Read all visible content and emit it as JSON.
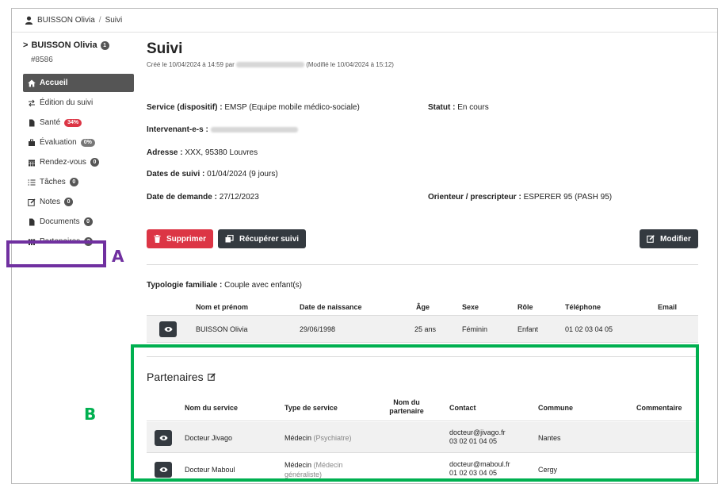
{
  "breadcrumb": {
    "person": "BUISSON Olivia",
    "separator": "/",
    "page": "Suivi"
  },
  "sidebar": {
    "patient_name": "BUISSON Olivia",
    "patient_badge": "1",
    "patient_id": "#8586",
    "items": [
      {
        "label": "Accueil",
        "icon": "home-icon",
        "badge": ""
      },
      {
        "label": "Édition du suivi",
        "icon": "swap-arrows-icon",
        "badge": ""
      },
      {
        "label": "Santé",
        "icon": "file-icon",
        "badge": "34%"
      },
      {
        "label": "Évaluation",
        "icon": "briefcase-icon",
        "badge": "0%"
      },
      {
        "label": "Rendez-vous",
        "icon": "calendar-icon",
        "badge": "0"
      },
      {
        "label": "Tâches",
        "icon": "list-icon",
        "badge": "0"
      },
      {
        "label": "Notes",
        "icon": "edit-icon",
        "badge": "0"
      },
      {
        "label": "Documents",
        "icon": "file-icon",
        "badge": "0"
      },
      {
        "label": "Partenaires",
        "icon": "people-icon",
        "badge": "2"
      }
    ]
  },
  "main": {
    "title": "Suivi",
    "meta_prefix": "Créé le 10/04/2024 à 14:59 par",
    "meta_suffix": "(Modifié le 10/04/2024 à 15:12)",
    "service_label": "Service (dispositif) :",
    "service_value": "EMSP (Equipe mobile médico-sociale)",
    "statut_label": "Statut :",
    "statut_value": "En cours",
    "intervenant_label": "Intervenant-e-s :",
    "adresse_label": "Adresse :",
    "adresse_value": "XXX, 95380 Louvres",
    "dates_label": "Dates de suivi :",
    "dates_value": "01/04/2024 (9 jours)",
    "demande_label": "Date de demande :",
    "demande_value": "27/12/2023",
    "orienteur_label": "Orienteur / prescripteur :",
    "orienteur_value": "ESPERER 95 (PASH 95)",
    "btn_supprimer": "Supprimer",
    "btn_recuperer": "Récupérer suivi",
    "btn_modifier": "Modifier",
    "typologie_label": "Typologie familiale :",
    "typologie_value": "Couple avec enfant(s)"
  },
  "family_table": {
    "headers": [
      "Nom et prénom",
      "Date de naissance",
      "Âge",
      "Sexe",
      "Rôle",
      "Téléphone",
      "Email"
    ],
    "rows": [
      {
        "name": "BUISSON Olivia",
        "dob": "29/06/1998",
        "age": "25 ans",
        "sexe": "Féminin",
        "role": "Enfant",
        "tel": "01 02 03 04 05",
        "email": ""
      }
    ]
  },
  "partenaires": {
    "title": "Partenaires",
    "headers": [
      "Nom du service",
      "Type de service",
      "Nom du partenaire",
      "Contact",
      "Commune",
      "Commentaire"
    ],
    "rows": [
      {
        "service": "Docteur Jivago",
        "type": "Médecin",
        "type_sub": "(Psychiatre)",
        "partner": "",
        "email": "docteur@jivago.fr",
        "phone": "03 02 01 04 05",
        "commune": "Nantes",
        "comment": ""
      },
      {
        "service": "Docteur Maboul",
        "type": "Médecin",
        "type_sub": "(Médecin généraliste)",
        "partner": "",
        "email": "docteur@maboul.fr",
        "phone": "01 02 03 04 05",
        "commune": "Cergy",
        "comment": ""
      }
    ]
  },
  "annotations": {
    "a": "A",
    "b": "B",
    "color_a": "#7030a0",
    "color_b": "#00b050"
  },
  "colors": {
    "accent_red": "#dc3545",
    "dark": "#343a40",
    "badge_red": "#dc3545",
    "badge_grey": "#555555"
  }
}
